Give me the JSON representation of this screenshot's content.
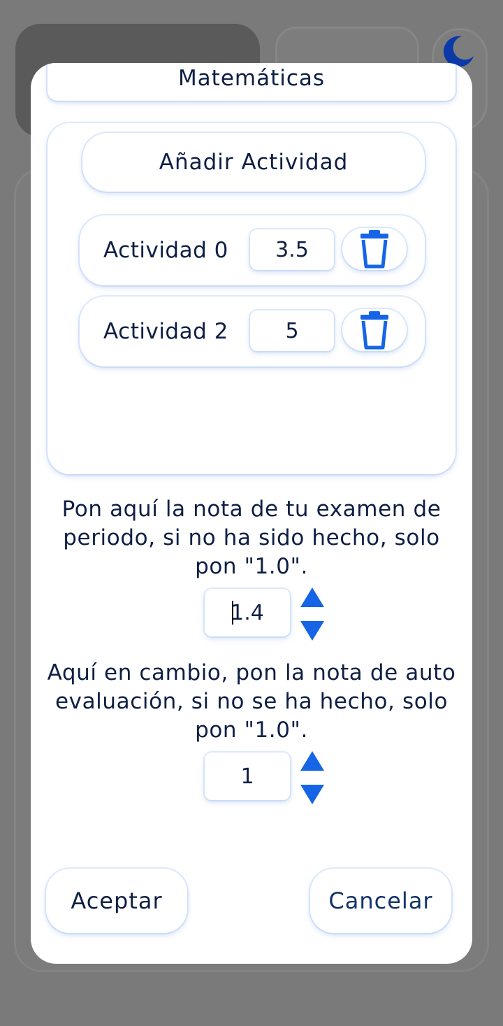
{
  "background": {
    "theme_toggle_icon": "moon-icon"
  },
  "dialog": {
    "subject_title": "Matemáticas",
    "add_activity_label": "Añadir Actividad",
    "activities": [
      {
        "name": "Actividad 0",
        "grade": "3.5",
        "delete_icon": "trash-icon"
      },
      {
        "name": "Actividad 2",
        "grade": "5",
        "delete_icon": "trash-icon"
      }
    ],
    "exam_instruction": "Pon aquí la nota de tu examen de periodo, si no ha sido hecho, solo pon \"1.0\".",
    "exam_grade": "1.4",
    "self_eval_instruction": "Aquí en cambio, pon la nota de auto evaluación, si no se ha hecho, solo pon \"1.0\".",
    "self_eval_grade": "1",
    "accept_label": "Aceptar",
    "cancel_label": "Cancelar"
  },
  "colors": {
    "accent": "#1565e6",
    "text": "#0e1f44",
    "cancel_text": "#12336b",
    "overlay": "#7a7a7a"
  }
}
